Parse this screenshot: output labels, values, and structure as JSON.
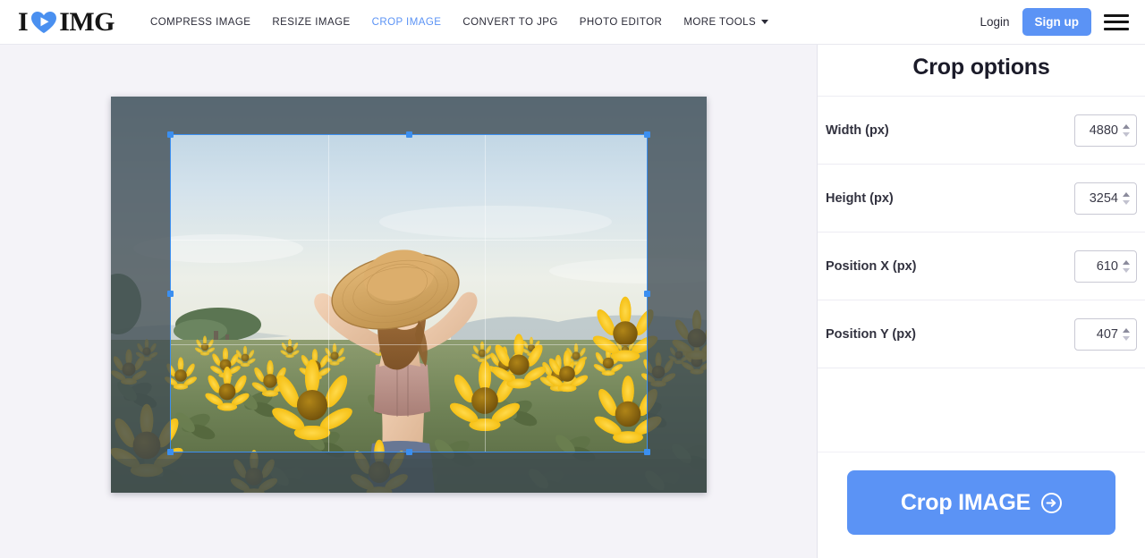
{
  "header": {
    "logo": {
      "text_left": "I",
      "text_right": "IMG",
      "icon": "heart-icon"
    },
    "nav": [
      {
        "label": "COMPRESS IMAGE",
        "active": false
      },
      {
        "label": "RESIZE IMAGE",
        "active": false
      },
      {
        "label": "CROP IMAGE",
        "active": true
      },
      {
        "label": "CONVERT TO JPG",
        "active": false
      },
      {
        "label": "PHOTO EDITOR",
        "active": false
      },
      {
        "label": "MORE TOOLS",
        "active": false,
        "has_caret": true
      }
    ],
    "login_label": "Login",
    "signup_label": "Sign up",
    "menu_icon": "hamburger-menu-icon",
    "accent_color": "#5b93f5",
    "active_link_color": "#5b93f5"
  },
  "editor": {
    "image_alt": "Woman in straw hat standing in a sunflower field",
    "crop_selection": {
      "handles": [
        "top-left",
        "top-center",
        "top-right",
        "middle-left",
        "middle-right",
        "bottom-left",
        "bottom-center",
        "bottom-right"
      ],
      "border_color": "#3b8ff0"
    }
  },
  "sidebar": {
    "title": "Crop options",
    "options": [
      {
        "label": "Width (px)",
        "value": "4880",
        "name": "width"
      },
      {
        "label": "Height (px)",
        "value": "3254",
        "name": "height"
      },
      {
        "label": "Position X (px)",
        "value": "610",
        "name": "position-x"
      },
      {
        "label": "Position Y (px)",
        "value": "407",
        "name": "position-y"
      }
    ],
    "action": {
      "label": "Crop IMAGE",
      "icon": "arrow-right-circle-icon"
    }
  }
}
